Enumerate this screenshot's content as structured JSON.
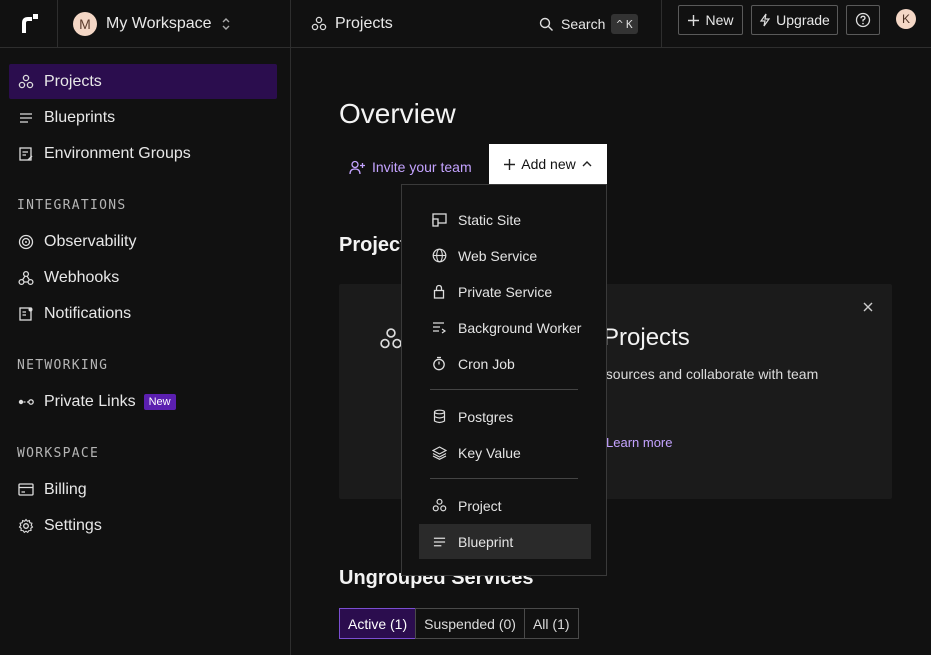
{
  "workspace": {
    "avatar_letter": "M",
    "name": "My Workspace"
  },
  "breadcrumb": {
    "label": "Projects"
  },
  "search": {
    "label": "Search",
    "shortcut_mod": "^",
    "shortcut_key": "K"
  },
  "topbar": {
    "new_label": "New",
    "upgrade_label": "Upgrade",
    "user_initial": "K"
  },
  "sidebar": {
    "items": [
      {
        "label": "Projects",
        "icon": "projects-icon"
      },
      {
        "label": "Blueprints",
        "icon": "blueprints-icon"
      },
      {
        "label": "Environment Groups",
        "icon": "environment-groups-icon"
      },
      {
        "label": "Observability",
        "icon": "observability-icon"
      },
      {
        "label": "Webhooks",
        "icon": "webhooks-icon"
      },
      {
        "label": "Notifications",
        "icon": "notifications-icon"
      },
      {
        "label": "Private Links",
        "icon": "private-links-icon",
        "badge": "New"
      },
      {
        "label": "Billing",
        "icon": "billing-icon"
      },
      {
        "label": "Settings",
        "icon": "settings-icon"
      }
    ],
    "sections": {
      "integrations": "INTEGRATIONS",
      "networking": "NETWORKING",
      "workspace": "WORKSPACE"
    }
  },
  "main": {
    "title": "Overview",
    "invite_label": "Invite your team",
    "add_new_label": "Add new",
    "projects_heading": "Project",
    "card": {
      "title": "h Projects",
      "desc": "esources and collaborate with team",
      "link": "Learn more"
    },
    "ungrouped_heading": "Ungrouped Services",
    "tabs": [
      "Active (1)",
      "Suspended (0)",
      "All (1)"
    ]
  },
  "dropdown": {
    "items": [
      {
        "label": "Static Site",
        "icon": "static-site-icon"
      },
      {
        "label": "Web Service",
        "icon": "globe-icon"
      },
      {
        "label": "Private Service",
        "icon": "lock-icon"
      },
      {
        "label": "Background Worker",
        "icon": "background-worker-icon"
      },
      {
        "label": "Cron Job",
        "icon": "stopwatch-icon"
      },
      {
        "label": "Postgres",
        "icon": "database-icon"
      },
      {
        "label": "Key Value",
        "icon": "layers-icon"
      },
      {
        "label": "Project",
        "icon": "projects-icon"
      },
      {
        "label": "Blueprint",
        "icon": "blueprints-icon"
      }
    ]
  },
  "colors": {
    "accent": "#2b0d4e",
    "link": "#c4a3ff",
    "badge": "#5b1fb0"
  }
}
